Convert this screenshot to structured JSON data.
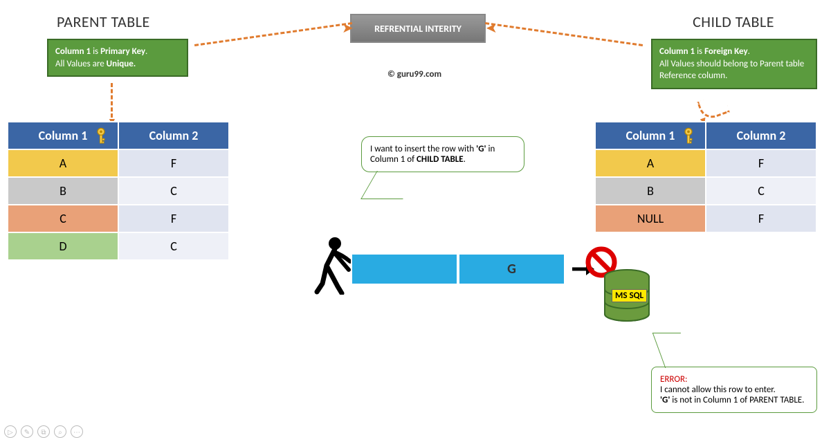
{
  "titles": {
    "parent": "PARENT TABLE",
    "child": "CHILD TABLE",
    "ref_integrity": "REFRENTIAL INTERITY"
  },
  "copyright": "© guru99.com",
  "notes": {
    "left_html": "<b>Column 1</b> is <b>Primary Key</b>.<br>All Values are <b>Unique.</b>",
    "right_html": "<b>Column 1</b> is <b>Foreign Key</b>.<br>All Values should belong to Parent table Reference column."
  },
  "parent_table": {
    "headers": [
      "Column 1",
      "Column 2"
    ],
    "rows": [
      {
        "c1": "A",
        "c2": "F",
        "style": "row-yellow row-light"
      },
      {
        "c1": "B",
        "c2": "C",
        "style": "row-gray row-light2"
      },
      {
        "c1": "C",
        "c2": "F",
        "style": "row-orange row-light"
      },
      {
        "c1": "D",
        "c2": "C",
        "style": "row-green row-light2"
      }
    ]
  },
  "child_table": {
    "headers": [
      "Column 1",
      "Column 2"
    ],
    "rows": [
      {
        "c1": "A",
        "c2": "F",
        "style": "row-yellow row-light"
      },
      {
        "c1": "B",
        "c2": "C",
        "style": "row-gray row-light2"
      },
      {
        "c1": "NULL",
        "c2": "F",
        "style": "row-orange row-light"
      }
    ]
  },
  "insert_bubble_html": "I want to insert the row with <b>'G'</b> in Column 1 of <b>CHILD TABLE</b>.",
  "insert_row": {
    "c1": "",
    "c2": "G"
  },
  "error_bubble": {
    "label": "ERROR:",
    "text_html": "I cannot allow this row to enter.<br><b>'G'</b> is not in Column 1 of PARENT TABLE."
  },
  "db_label": "MS SQL",
  "chart_data": {
    "type": "table",
    "title": "Referential Integrity: Parent vs Child Table",
    "parent": {
      "headers": [
        "Column 1",
        "Column 2"
      ],
      "rows": [
        [
          "A",
          "F"
        ],
        [
          "B",
          "C"
        ],
        [
          "C",
          "F"
        ],
        [
          "D",
          "C"
        ]
      ],
      "key": "Primary Key on Column 1 (unique)"
    },
    "child": {
      "headers": [
        "Column 1",
        "Column 2"
      ],
      "rows": [
        [
          "A",
          "F"
        ],
        [
          "B",
          "C"
        ],
        [
          "NULL",
          "F"
        ]
      ],
      "key": "Foreign Key on Column 1 referencing Parent.Column 1"
    },
    "attempted_insert": {
      "table": "CHILD",
      "row": [
        "G",
        ""
      ],
      "rejected": true,
      "reason": "'G' not present in Parent.Column 1"
    }
  }
}
